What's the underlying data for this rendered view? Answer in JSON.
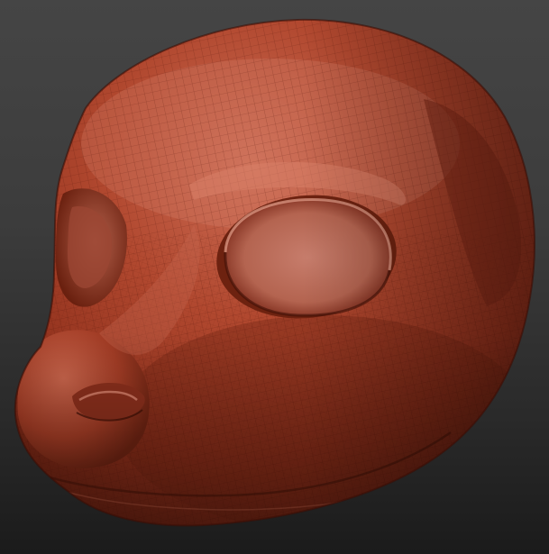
{
  "scene": {
    "subject_icon": "sculpted-animal-head-mask",
    "colors": {
      "background_top": "#464646",
      "background_bottom": "#1b1b1b",
      "material_base": "#a13a26",
      "material_highlight": "#d27a62",
      "material_shadow": "#4a1409",
      "wireframe": "#5a1a0c"
    }
  }
}
